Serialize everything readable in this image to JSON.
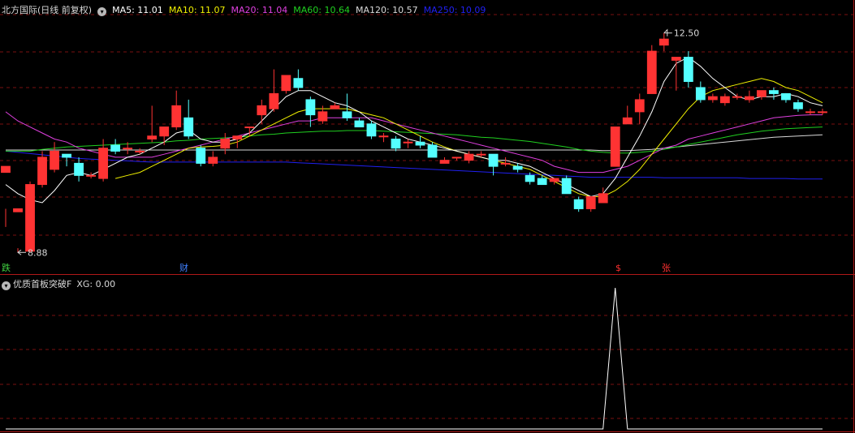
{
  "main_header": {
    "stock_name": "北方国际",
    "period_adjust": "(日线 前复权)",
    "indicators": [
      {
        "label": "MA5: 11.01",
        "color": "#ffffff"
      },
      {
        "label": "MA10: 11.07",
        "color": "#f0f000"
      },
      {
        "label": "MA20: 11.04",
        "color": "#e040e0"
      },
      {
        "label": "MA60: 10.64",
        "color": "#20d020"
      },
      {
        "label": "MA120: 10.57",
        "color": "#d8d8d8"
      },
      {
        "label": "MA250: 10.09",
        "color": "#2020f0"
      }
    ]
  },
  "chart_labels": {
    "high": "12.50",
    "low": "8.88"
  },
  "event_markers": [
    {
      "text": "跌",
      "color": "#40d040"
    },
    {
      "text": "财",
      "color": "#4080ff"
    },
    {
      "text": "$",
      "color": "#ff3030"
    },
    {
      "text": "张",
      "color": "#ff3030"
    }
  ],
  "sub_header": {
    "name": "优质首板突破F",
    "value": "XG: 0.00"
  },
  "colors": {
    "up": "#ff3333",
    "down": "#54ffff",
    "grid": "#7a1010",
    "divider": "#b01818"
  },
  "chart_data": {
    "type": "candlestick",
    "ohlc": [
      [
        10.2,
        10.3,
        9.6,
        9.3
      ],
      [
        9.55,
        9.6,
        8.95,
        8.88
      ],
      [
        8.9,
        10.0,
        10.05,
        8.88
      ],
      [
        10.0,
        10.45,
        10.55,
        9.95
      ],
      [
        10.25,
        10.55,
        10.7,
        10.2
      ],
      [
        10.5,
        10.45,
        10.5,
        10.3
      ],
      [
        10.35,
        10.15,
        10.45,
        10.05
      ],
      [
        10.15,
        10.15,
        10.2,
        10.1
      ],
      [
        10.1,
        10.6,
        10.75,
        10.05
      ],
      [
        10.65,
        10.55,
        10.75,
        10.5
      ],
      [
        10.6,
        10.6,
        10.7,
        10.5
      ],
      [
        10.55,
        10.55,
        10.6,
        10.5
      ],
      [
        10.75,
        10.8,
        11.3,
        10.7
      ],
      [
        10.8,
        10.95,
        10.95,
        10.65
      ],
      [
        10.95,
        11.3,
        11.55,
        10.9
      ],
      [
        11.1,
        10.8,
        11.4,
        10.75
      ],
      [
        10.6,
        10.35,
        10.65,
        10.3
      ],
      [
        10.35,
        10.45,
        10.55,
        10.3
      ],
      [
        10.6,
        10.75,
        10.85,
        10.5
      ],
      [
        10.75,
        10.8,
        10.8,
        10.6
      ],
      [
        10.95,
        10.95,
        10.95,
        10.8
      ],
      [
        11.15,
        11.3,
        11.4,
        11.0
      ],
      [
        11.25,
        11.5,
        11.9,
        11.2
      ],
      [
        11.55,
        11.8,
        11.8,
        11.5
      ],
      [
        11.75,
        11.6,
        11.9,
        11.55
      ],
      [
        11.4,
        11.15,
        11.45,
        10.95
      ],
      [
        11.05,
        11.2,
        11.3,
        11.0
      ],
      [
        11.25,
        11.3,
        11.35,
        11.25
      ],
      [
        11.2,
        11.1,
        11.5,
        11.05
      ],
      [
        11.05,
        10.95,
        11.1,
        10.95
      ],
      [
        11.0,
        10.8,
        11.05,
        10.75
      ],
      [
        10.8,
        10.8,
        10.85,
        10.7
      ],
      [
        10.75,
        10.6,
        10.8,
        10.55
      ],
      [
        10.7,
        10.7,
        10.75,
        10.6
      ],
      [
        10.7,
        10.65,
        10.8,
        10.6
      ],
      [
        10.65,
        10.45,
        10.7,
        10.45
      ],
      [
        10.35,
        10.4,
        10.45,
        10.35
      ],
      [
        10.45,
        10.45,
        10.45,
        10.4
      ],
      [
        10.4,
        10.5,
        10.55,
        10.35
      ],
      [
        10.5,
        10.5,
        10.55,
        10.45
      ],
      [
        10.5,
        10.3,
        10.5,
        10.15
      ],
      [
        10.35,
        10.35,
        10.45,
        10.3
      ],
      [
        10.3,
        10.25,
        10.35,
        10.2
      ],
      [
        10.15,
        10.05,
        10.2,
        10.0
      ],
      [
        10.1,
        10.0,
        10.15,
        10.0
      ],
      [
        10.05,
        10.1,
        10.1,
        10.0
      ],
      [
        10.1,
        9.85,
        10.15,
        9.85
      ],
      [
        9.75,
        9.6,
        9.8,
        9.55
      ],
      [
        9.6,
        9.8,
        9.8,
        9.55
      ],
      [
        9.7,
        9.85,
        9.95,
        9.7
      ],
      [
        10.3,
        10.95,
        10.95,
        10.3
      ],
      [
        11.0,
        11.1,
        11.3,
        11.05
      ],
      [
        11.2,
        11.4,
        11.5,
        11.0
      ],
      [
        11.5,
        12.2,
        12.3,
        11.5
      ],
      [
        12.3,
        12.4,
        12.5,
        12.2
      ],
      [
        12.05,
        12.1,
        12.1,
        11.55
      ],
      [
        12.1,
        11.7,
        12.2,
        11.6
      ],
      [
        11.6,
        11.4,
        11.7,
        11.35
      ],
      [
        11.4,
        11.45,
        11.5,
        11.35
      ],
      [
        11.35,
        11.45,
        11.5,
        11.3
      ],
      [
        11.45,
        11.45,
        11.5,
        11.4
      ],
      [
        11.4,
        11.45,
        11.55,
        11.35
      ],
      [
        11.45,
        11.55,
        11.55,
        11.4
      ],
      [
        11.55,
        11.5,
        11.6,
        11.4
      ],
      [
        11.5,
        11.4,
        11.5,
        11.35
      ],
      [
        11.35,
        11.25,
        11.4,
        11.2
      ],
      [
        11.2,
        11.2,
        11.25,
        11.15
      ],
      [
        11.2,
        11.2,
        11.25,
        11.15
      ]
    ],
    "ma5": [
      10.0,
      9.85,
      9.75,
      9.7,
      9.9,
      10.15,
      10.2,
      10.15,
      10.25,
      10.35,
      10.45,
      10.5,
      10.6,
      10.7,
      10.85,
      10.9,
      10.75,
      10.7,
      10.7,
      10.75,
      10.85,
      11.05,
      11.25,
      11.45,
      11.55,
      11.55,
      11.45,
      11.35,
      11.3,
      11.2,
      11.05,
      10.95,
      10.85,
      10.75,
      10.7,
      10.65,
      10.6,
      10.55,
      10.5,
      10.45,
      10.4,
      10.4,
      10.35,
      10.3,
      10.2,
      10.1,
      10.0,
      9.9,
      9.8,
      9.85,
      10.1,
      10.45,
      10.8,
      11.2,
      11.7,
      12.0,
      12.1,
      11.95,
      11.75,
      11.6,
      11.45,
      11.4,
      11.45,
      11.45,
      11.5,
      11.45,
      11.35,
      11.3
    ],
    "ma10": [
      null,
      null,
      null,
      null,
      null,
      null,
      null,
      null,
      null,
      10.1,
      10.15,
      10.2,
      10.3,
      10.4,
      10.5,
      10.6,
      10.62,
      10.63,
      10.65,
      10.7,
      10.8,
      10.9,
      11.0,
      11.1,
      11.2,
      11.25,
      11.25,
      11.25,
      11.25,
      11.2,
      11.15,
      11.1,
      11.0,
      10.9,
      10.8,
      10.7,
      10.62,
      10.55,
      10.5,
      10.45,
      10.4,
      10.35,
      10.3,
      10.25,
      10.15,
      10.05,
      9.95,
      9.85,
      9.8,
      9.8,
      9.9,
      10.05,
      10.25,
      10.5,
      10.75,
      11.0,
      11.25,
      11.45,
      11.55,
      11.6,
      11.65,
      11.7,
      11.75,
      11.7,
      11.6,
      11.55,
      11.45,
      11.35
    ],
    "ma20": [
      11.2,
      11.05,
      10.95,
      10.85,
      10.75,
      10.7,
      10.6,
      10.55,
      10.5,
      10.45,
      10.45,
      10.45,
      10.45,
      10.5,
      10.55,
      10.6,
      10.65,
      10.7,
      10.75,
      10.8,
      10.85,
      10.9,
      10.95,
      11.0,
      11.05,
      11.05,
      11.1,
      11.1,
      11.1,
      11.1,
      11.1,
      11.05,
      11.0,
      10.95,
      10.9,
      10.85,
      10.8,
      10.75,
      10.7,
      10.65,
      10.6,
      10.55,
      10.5,
      10.45,
      10.4,
      10.3,
      10.25,
      10.2,
      10.2,
      10.2,
      10.25,
      10.3,
      10.4,
      10.5,
      10.6,
      10.65,
      10.75,
      10.8,
      10.85,
      10.9,
      10.95,
      11.0,
      11.05,
      11.1,
      11.12,
      11.14,
      11.15,
      11.15
    ],
    "ma60": [
      10.55,
      10.55,
      10.55,
      10.58,
      10.6,
      10.62,
      10.63,
      10.64,
      10.65,
      10.66,
      10.67,
      10.68,
      10.69,
      10.7,
      10.72,
      10.73,
      10.75,
      10.76,
      10.77,
      10.78,
      10.8,
      10.82,
      10.83,
      10.85,
      10.86,
      10.87,
      10.88,
      10.88,
      10.89,
      10.89,
      10.89,
      10.88,
      10.87,
      10.86,
      10.85,
      10.84,
      10.83,
      10.82,
      10.8,
      10.78,
      10.77,
      10.75,
      10.73,
      10.71,
      10.68,
      10.65,
      10.62,
      10.58,
      10.55,
      10.53,
      10.52,
      10.52,
      10.53,
      10.55,
      10.58,
      10.62,
      10.66,
      10.7,
      10.74,
      10.78,
      10.82,
      10.85,
      10.88,
      10.9,
      10.92,
      10.93,
      10.94,
      10.95
    ],
    "ma120": [
      10.57,
      10.57,
      10.57,
      10.57,
      10.57,
      10.57,
      10.57,
      10.57,
      10.57,
      10.57,
      10.57,
      10.57,
      10.57,
      10.57,
      10.57,
      10.57,
      10.57,
      10.57,
      10.57,
      10.57,
      10.57,
      10.57,
      10.57,
      10.57,
      10.57,
      10.57,
      10.57,
      10.57,
      10.57,
      10.57,
      10.57,
      10.57,
      10.57,
      10.57,
      10.57,
      10.57,
      10.57,
      10.57,
      10.57,
      10.57,
      10.57,
      10.57,
      10.57,
      10.57,
      10.57,
      10.57,
      10.57,
      10.57,
      10.57,
      10.56,
      10.56,
      10.56,
      10.57,
      10.58,
      10.6,
      10.62,
      10.64,
      10.66,
      10.68,
      10.7,
      10.72,
      10.74,
      10.76,
      10.78,
      10.79,
      10.8,
      10.81,
      10.82
    ],
    "ma250": [
      10.55,
      10.53,
      10.51,
      10.49,
      10.47,
      10.45,
      10.43,
      10.42,
      10.41,
      10.4,
      10.39,
      10.38,
      10.37,
      10.37,
      10.37,
      10.37,
      10.37,
      10.37,
      10.37,
      10.37,
      10.37,
      10.37,
      10.37,
      10.37,
      10.36,
      10.35,
      10.34,
      10.33,
      10.32,
      10.31,
      10.3,
      10.29,
      10.28,
      10.27,
      10.26,
      10.25,
      10.24,
      10.23,
      10.22,
      10.21,
      10.2,
      10.19,
      10.18,
      10.17,
      10.16,
      10.15,
      10.14,
      10.13,
      10.12,
      10.12,
      10.12,
      10.12,
      10.12,
      10.12,
      10.11,
      10.11,
      10.11,
      10.11,
      10.11,
      10.11,
      10.11,
      10.1,
      10.1,
      10.1,
      10.1,
      10.09,
      10.09,
      10.09
    ],
    "xg_signal": [
      0,
      0,
      0,
      0,
      0,
      0,
      0,
      0,
      0,
      0,
      0,
      0,
      0,
      0,
      0,
      0,
      0,
      0,
      0,
      0,
      0,
      0,
      0,
      0,
      0,
      0,
      0,
      0,
      0,
      0,
      0,
      0,
      0,
      0,
      0,
      0,
      0,
      0,
      0,
      0,
      0,
      0,
      0,
      0,
      0,
      0,
      0,
      0,
      0,
      0,
      1,
      0,
      0,
      0,
      0,
      0,
      0,
      0,
      0,
      0,
      0,
      0,
      0,
      0,
      0,
      0,
      0,
      0
    ]
  }
}
